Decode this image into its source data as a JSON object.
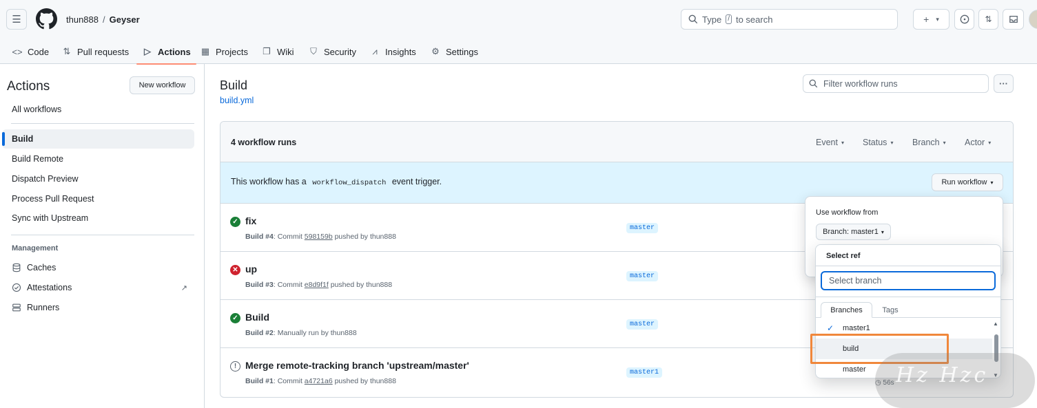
{
  "header": {
    "owner": "thun888",
    "separator": "/",
    "repo": "Geyser",
    "search_prefix": "Type",
    "search_key": "/",
    "search_suffix": "to search",
    "plus_label": "+",
    "caret": "▾"
  },
  "tabs": [
    {
      "label": "Code",
      "icon": "code-icon",
      "glyph": "<>"
    },
    {
      "label": "Pull requests",
      "icon": "pull-request-icon",
      "glyph": "⇅"
    },
    {
      "label": "Actions",
      "icon": "play-icon",
      "glyph": "▷"
    },
    {
      "label": "Projects",
      "icon": "table-icon",
      "glyph": "▦"
    },
    {
      "label": "Wiki",
      "icon": "book-icon",
      "glyph": "📖"
    },
    {
      "label": "Security",
      "icon": "shield-icon",
      "glyph": "⛉"
    },
    {
      "label": "Insights",
      "icon": "graph-icon",
      "glyph": "📈"
    },
    {
      "label": "Settings",
      "icon": "gear-icon",
      "glyph": "⚙"
    }
  ],
  "sidebar": {
    "title": "Actions",
    "new_workflow": "New workflow",
    "all_workflows": "All workflows",
    "workflows": [
      "Build",
      "Build Remote",
      "Dispatch Preview",
      "Process Pull Request",
      "Sync with Upstream"
    ],
    "management_label": "Management",
    "management": [
      {
        "label": "Caches",
        "icon": "database-icon"
      },
      {
        "label": "Attestations",
        "icon": "verified-icon"
      },
      {
        "label": "Runners",
        "icon": "server-icon"
      }
    ],
    "external_glyph": "↗"
  },
  "main": {
    "title": "Build",
    "file": "build.yml",
    "filter_placeholder": "Filter workflow runs",
    "more": "···",
    "run_count": "4 workflow runs",
    "filters": [
      "Event",
      "Status",
      "Branch",
      "Actor"
    ],
    "banner_prefix": "This workflow has a",
    "banner_code": "workflow_dispatch",
    "banner_suffix": "event trigger.",
    "run_workflow": "Run workflow"
  },
  "runs": [
    {
      "title": "fix",
      "status": "success",
      "glyph": "✓",
      "wf": "Build",
      "num": "#4",
      "text": ": Commit ",
      "commit": "598159b",
      "after": " pushed by thun888",
      "branch": "master"
    },
    {
      "title": "up",
      "status": "failure",
      "glyph": "✕",
      "wf": "Build",
      "num": "#3",
      "text": ": Commit ",
      "commit": "e8d9f1f",
      "after": " pushed by thun888",
      "branch": "master"
    },
    {
      "title": "Build",
      "status": "success",
      "glyph": "✓",
      "wf": "Build",
      "num": "#2",
      "text": ": Manually run by thun888",
      "commit": "",
      "after": "",
      "branch": "master"
    },
    {
      "title": "Merge remote-tracking branch 'upstream/master'",
      "status": "neutral",
      "glyph": "!",
      "wf": "Build",
      "num": "#1",
      "text": ": Commit ",
      "commit": "a4721a6",
      "after": " pushed by thun888",
      "branch": "master1"
    }
  ],
  "duration": "56s",
  "popover": {
    "use_from": "Use workflow from",
    "branch_button": "Branch: master1"
  },
  "dropdown": {
    "header": "Select ref",
    "placeholder": "Select branch",
    "tabs": [
      "Branches",
      "Tags"
    ],
    "items": [
      "master1",
      "build",
      "master"
    ],
    "selected": "master1",
    "check": "✓"
  },
  "watermark": "Hz Hzc",
  "colors": {
    "accent": "#0969da",
    "success": "#1a7f37",
    "failure": "#cf222e",
    "highlight": "#f0873b",
    "tab_underline": "#fd8c73"
  }
}
